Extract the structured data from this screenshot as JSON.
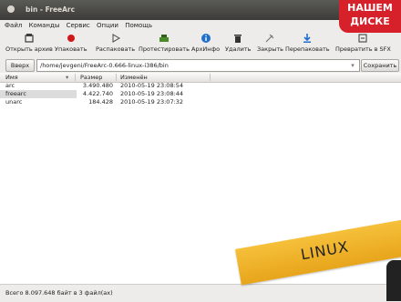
{
  "window": {
    "title": "bin - FreeArc"
  },
  "menu": [
    "Файл",
    "Команды",
    "Сервис",
    "Опции",
    "Помощь"
  ],
  "toolbar": [
    {
      "label": "Открыть архив",
      "icon": "open-archive-icon",
      "color": "#3b3b3b"
    },
    {
      "label": "Упаковать",
      "icon": "record-icon",
      "color": "#d01818"
    },
    {
      "label": "Распаковать",
      "icon": "play-icon",
      "color": "#555555"
    },
    {
      "label": "Протестировать",
      "icon": "test-icon",
      "color": "#4a8a2a"
    },
    {
      "label": "АрхИнфо",
      "icon": "info-icon",
      "color": "#1f6fd0"
    },
    {
      "label": "Удалить",
      "icon": "trash-icon",
      "color": "#333333"
    },
    {
      "label": "Закрыть",
      "icon": "close-archive-icon",
      "color": "#777777"
    },
    {
      "label": "Перепаковать",
      "icon": "repack-icon",
      "color": "#1f6fd0"
    },
    {
      "label": "Превратить в SFX",
      "icon": "sfx-icon",
      "color": "#444444"
    }
  ],
  "address": {
    "up_label": "Вверх",
    "path": "/home/jevgeni/FreeArc-0.666-linux-i386/bin",
    "save_label": "Сохранить"
  },
  "table": {
    "columns": [
      "Имя",
      "Размер",
      "Изменён"
    ],
    "rows": [
      {
        "name": "arc",
        "size": "3.490.480",
        "modified": "2010-05-19 23:08:54"
      },
      {
        "name": "freearc",
        "size": "4.422.740",
        "modified": "2010-05-19 23:08:44"
      },
      {
        "name": "unarc",
        "size": "184.428",
        "modified": "2010-05-19 23:07:32"
      }
    ]
  },
  "status": "Всего 8.097.648 байт в 3 файл(ах)",
  "promo": {
    "line1": "НАШЕМ",
    "line2": "ДИСКЕ",
    "ribbon": "LINUX"
  }
}
